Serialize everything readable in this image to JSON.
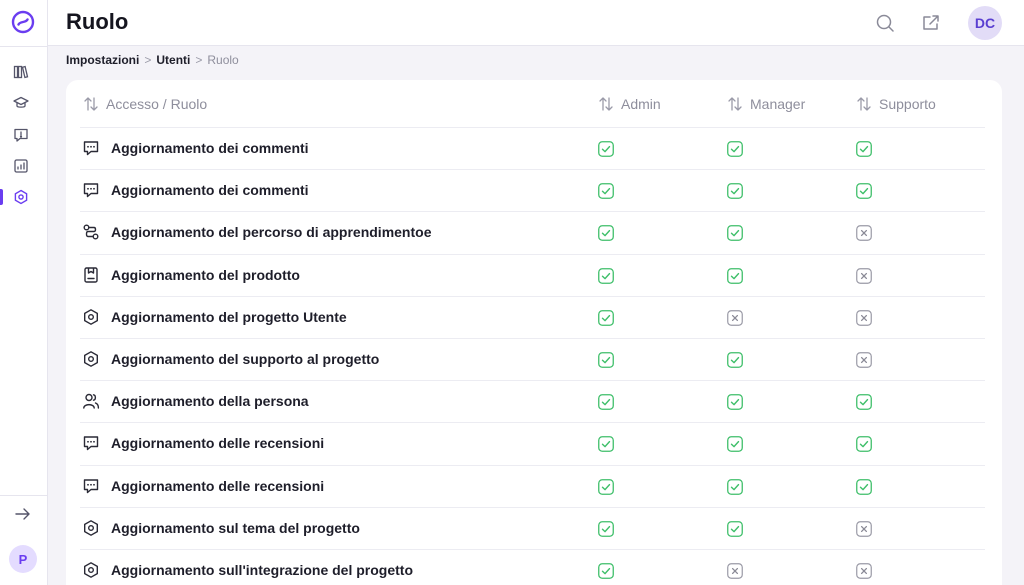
{
  "header": {
    "title": "Ruolo",
    "avatar_initials": "DC"
  },
  "sidebar": {
    "workspace_initial": "P",
    "items": [
      {
        "name": "library",
        "icon": "books-icon"
      },
      {
        "name": "learning",
        "icon": "graduation-cap-icon"
      },
      {
        "name": "feedback",
        "icon": "message-alert-icon"
      },
      {
        "name": "analytics",
        "icon": "chart-icon"
      },
      {
        "name": "settings",
        "icon": "settings-hex-icon",
        "active": true
      }
    ]
  },
  "breadcrumb": {
    "items": [
      "Impostazioni",
      "Utenti"
    ],
    "current": "Ruolo",
    "separator": ">"
  },
  "table": {
    "columns": [
      "Accesso / Ruolo",
      "Admin",
      "Manager",
      "Supporto"
    ],
    "rows": [
      {
        "icon": "chat",
        "label": "Aggiornamento dei commenti",
        "admin": true,
        "manager": true,
        "supporto": true
      },
      {
        "icon": "chat",
        "label": "Aggiornamento dei commenti",
        "admin": true,
        "manager": true,
        "supporto": true
      },
      {
        "icon": "route",
        "label": "Aggiornamento del percorso di apprendimentoe",
        "admin": true,
        "manager": true,
        "supporto": false
      },
      {
        "icon": "product",
        "label": "Aggiornamento del prodotto",
        "admin": true,
        "manager": true,
        "supporto": false
      },
      {
        "icon": "hex",
        "label": "Aggiornamento del progetto Utente",
        "admin": true,
        "manager": false,
        "supporto": false
      },
      {
        "icon": "hex",
        "label": "Aggiornamento del supporto al progetto",
        "admin": true,
        "manager": true,
        "supporto": false
      },
      {
        "icon": "users",
        "label": "Aggiornamento della persona",
        "admin": true,
        "manager": true,
        "supporto": true
      },
      {
        "icon": "chat",
        "label": "Aggiornamento delle recensioni",
        "admin": true,
        "manager": true,
        "supporto": true
      },
      {
        "icon": "chat",
        "label": "Aggiornamento delle recensioni",
        "admin": true,
        "manager": true,
        "supporto": true
      },
      {
        "icon": "hex",
        "label": "Aggiornamento sul tema del progetto",
        "admin": true,
        "manager": true,
        "supporto": false
      },
      {
        "icon": "hex",
        "label": "Aggiornamento sull'integrazione del progetto",
        "admin": true,
        "manager": false,
        "supporto": false
      }
    ]
  },
  "colors": {
    "accent": "#6a3df0",
    "check": "#3fbf6a",
    "cross": "#9a9aa6"
  }
}
